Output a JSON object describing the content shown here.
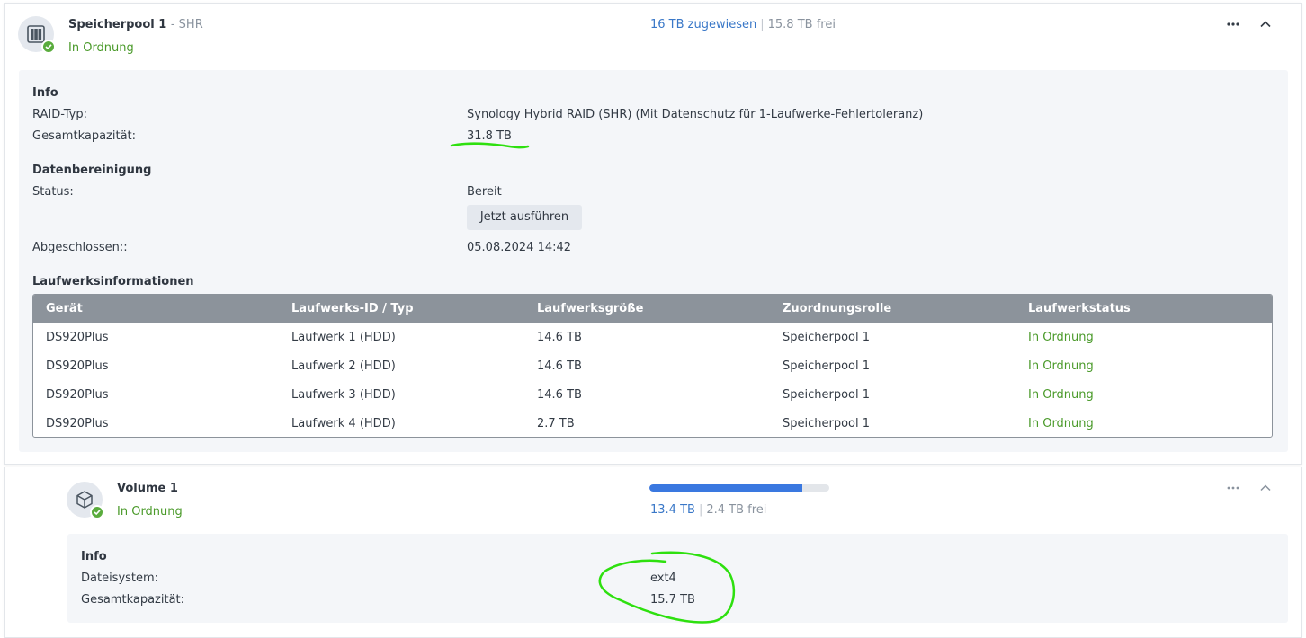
{
  "pool": {
    "name": "Speicherpool 1",
    "type_suffix": "- SHR",
    "status": "In Ordnung",
    "allocated": "16 TB zugewiesen",
    "separator": "|",
    "free": "15.8 TB frei",
    "more_icon": "more-dots-icon",
    "collapse_icon": "chevron-up-icon",
    "info": {
      "heading": "Info",
      "raid_label": "RAID-Typ:",
      "raid_value": "Synology Hybrid RAID (SHR) (Mit Datenschutz für 1-Laufwerke-Fehlertoleranz)",
      "capacity_label": "Gesamtkapazität:",
      "capacity_value": "31.8 TB"
    },
    "scrub": {
      "heading": "Datenbereinigung",
      "status_label": "Status:",
      "status_value": "Bereit",
      "run_button": "Jetzt ausführen",
      "completed_label": "Abgeschlossen::",
      "completed_value": "05.08.2024 14:42"
    },
    "drives": {
      "heading": "Laufwerksinformationen",
      "columns": [
        "Gerät",
        "Laufwerks-ID / Typ",
        "Laufwerksgröße",
        "Zuordnungsrolle",
        "Laufwerkstatus"
      ],
      "rows": [
        [
          "DS920Plus",
          "Laufwerk 1 (HDD)",
          "14.6 TB",
          "Speicherpool 1",
          "In Ordnung"
        ],
        [
          "DS920Plus",
          "Laufwerk 2 (HDD)",
          "14.6 TB",
          "Speicherpool 1",
          "In Ordnung"
        ],
        [
          "DS920Plus",
          "Laufwerk 3 (HDD)",
          "14.6 TB",
          "Speicherpool 1",
          "In Ordnung"
        ],
        [
          "DS920Plus",
          "Laufwerk 4 (HDD)",
          "2.7 TB",
          "Speicherpool 1",
          "In Ordnung"
        ]
      ]
    }
  },
  "volume": {
    "name": "Volume 1",
    "status": "In Ordnung",
    "used": "13.4 TB",
    "separator": "|",
    "free": "2.4 TB frei",
    "usage_fraction": 0.85,
    "info": {
      "heading": "Info",
      "fs_label": "Dateisystem:",
      "fs_value": "ext4",
      "capacity_label": "Gesamtkapazität:",
      "capacity_value": "15.7 TB"
    }
  },
  "colors": {
    "ok_green": "#4a9a2a",
    "link_blue": "#3a78c8",
    "bar_blue": "#3a78e0",
    "annotation_green": "#2ee00f"
  }
}
